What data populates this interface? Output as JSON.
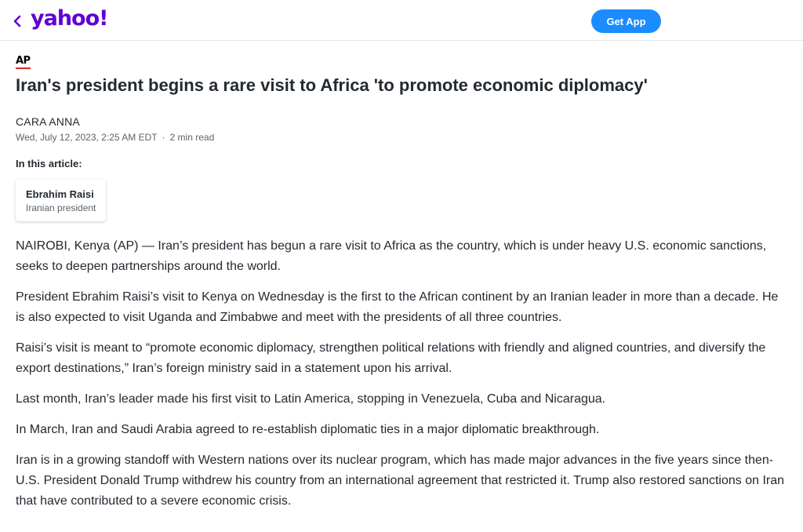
{
  "header": {
    "logo_text": "yahoo!",
    "get_app_label": "Get App"
  },
  "article": {
    "source": "AP",
    "headline": "Iran's president begins a rare visit to Africa 'to promote economic diplomacy'",
    "author": "CARA ANNA",
    "date": "Wed, July 12, 2023, 2:25 AM EDT",
    "separator": "·",
    "read_time": "2 min read",
    "in_this_article_label": "In this article:",
    "entity": {
      "name": "Ebrahim Raisi",
      "role": "Iranian president"
    },
    "paragraphs": [
      "NAIROBI, Kenya (AP) — Iran’s president has begun a rare visit to Africa as the country, which is under heavy U.S. economic sanctions, seeks to deepen partnerships around the world.",
      "President Ebrahim Raisi’s visit to Kenya on Wednesday is the first to the African continent by an Iranian leader in more than a decade. He is also expected to visit Uganda and Zimbabwe and meet with the presidents of all three countries.",
      "Raisi’s visit is meant to “promote economic diplomacy, strengthen political relations with friendly and aligned countries, and diversify the export destinations,” Iran’s foreign ministry said in a statement upon his arrival.",
      "Last month, Iran’s leader made his first visit to Latin America, stopping in Venezuela, Cuba and Nicaragua.",
      "In March, Iran and Saudi Arabia agreed to re-establish diplomatic ties in a major diplomatic breakthrough.",
      "Iran is in a growing standoff with Western nations over its nuclear program, which has made major advances in the five years since then-U.S. President Donald Trump withdrew his country from an international agreement that restricted it. Trump also restored sanctions on Iran that have contributed to a severe economic crisis."
    ]
  },
  "colors": {
    "brand": "#6001d2",
    "button": "#1a8cff",
    "ap_underline": "#e0261f"
  }
}
